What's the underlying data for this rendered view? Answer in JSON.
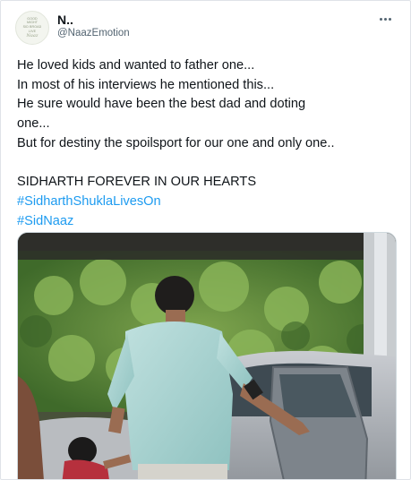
{
  "tweet": {
    "display_name": "N..",
    "handle": "@NaazEmotion",
    "avatar_text": [
      "GOOD",
      "MIGHT",
      "SID BROAD",
      "LIVE"
    ],
    "avatar_signature": "Naaz",
    "lines": [
      "He loved kids and wanted to father one...",
      "In most of his interviews he mentioned this...",
      "He sure would have been the best dad and doting",
      "one...",
      "But for destiny the spoilsport for our one and only one..",
      "",
      "SIDHARTH FOREVER IN OUR HEARTS"
    ],
    "hashtags": [
      "#SidharthShuklaLivesOn",
      "#SidNaaz"
    ]
  },
  "icons": {
    "more": "more-horizontal-icon"
  },
  "colors": {
    "text": "#0f1419",
    "secondary": "#536471",
    "link": "#1d9bf0",
    "border": "#cfd9de"
  }
}
